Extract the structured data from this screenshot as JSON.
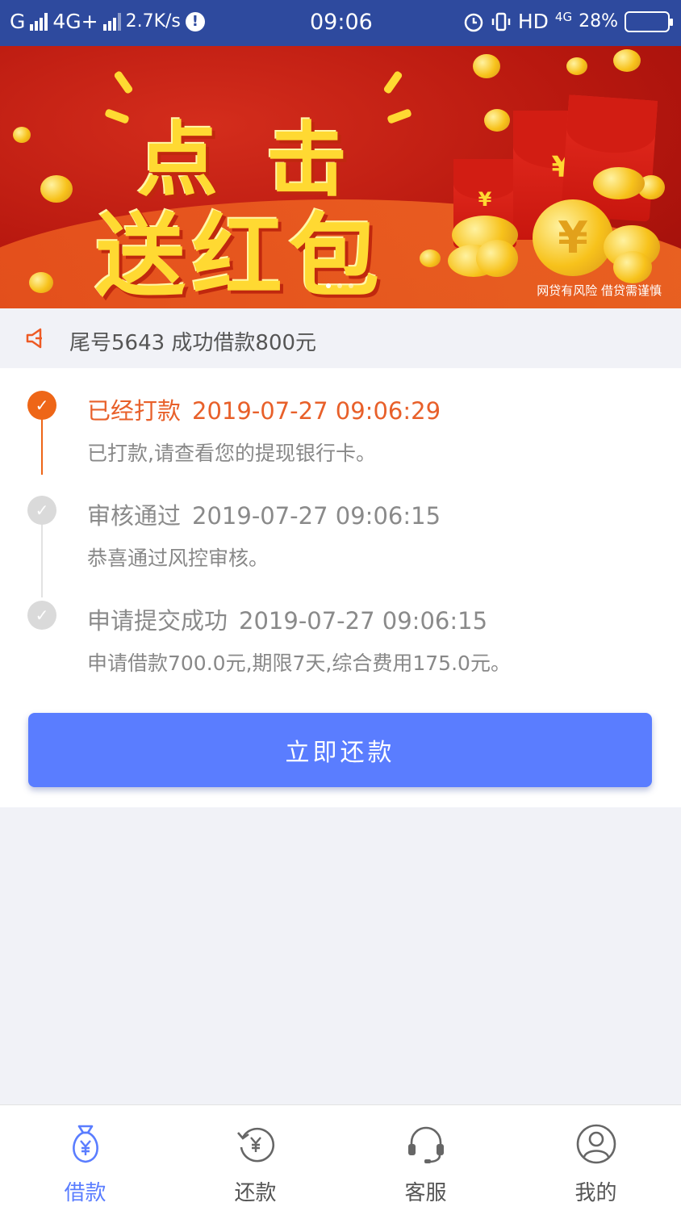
{
  "status_bar": {
    "carrier_left": "G",
    "network": "4G+",
    "speed": "2.7K/s",
    "time": "09:06",
    "hd": "HD",
    "lte": "4G",
    "battery": "28%",
    "battery_level": 0.28
  },
  "banner": {
    "title_line1": "点击",
    "title_line2": "送红包",
    "envelope_symbol": "¥",
    "note": "网贷有风险  借贷需谨慎",
    "page_count": 3,
    "active_page": 1
  },
  "notice": {
    "icon": "speaker-icon",
    "text": "尾号5643 成功借款800元"
  },
  "timeline": [
    {
      "status": "active",
      "title": "已经打款",
      "timestamp": "2019-07-27 09:06:29",
      "description": "已打款,请查看您的提现银行卡。"
    },
    {
      "status": "done",
      "title": "审核通过",
      "timestamp": "2019-07-27 09:06:15",
      "description": "恭喜通过风控审核。"
    },
    {
      "status": "done",
      "title": "申请提交成功",
      "timestamp": "2019-07-27 09:06:15",
      "description": "申请借款700.0元,期限7天,综合费用175.0元。"
    }
  ],
  "repay_button": "立即还款",
  "bottom_nav": [
    {
      "label": "借款",
      "icon": "money-bag-icon",
      "active": true
    },
    {
      "label": "还款",
      "icon": "repay-cycle-icon",
      "active": false
    },
    {
      "label": "客服",
      "icon": "headset-icon",
      "active": false
    },
    {
      "label": "我的",
      "icon": "user-profile-icon",
      "active": false
    }
  ],
  "colors": {
    "status_bar": "#2e4a9e",
    "accent_blue": "#5a7dff",
    "active_orange": "#ee6617",
    "inactive_gray": "#dadada"
  }
}
